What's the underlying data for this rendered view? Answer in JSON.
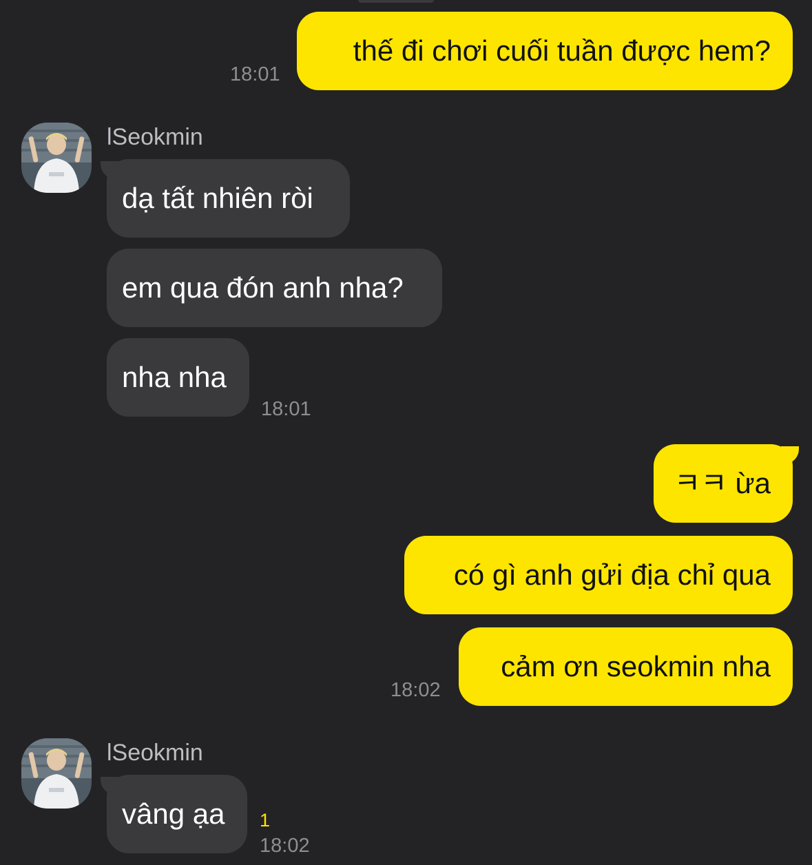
{
  "chat": {
    "contact_name": "lSeokmin",
    "messages": [
      {
        "text": "thế đi chơi cuối tuần được hem?",
        "time": "18:01"
      },
      {
        "text": "dạ tất nhiên ròi"
      },
      {
        "text": "em qua đón anh nha?"
      },
      {
        "text": "nha nha",
        "time": "18:01"
      },
      {
        "text": "ㅋㅋ ừa"
      },
      {
        "text": "có gì anh gửi địa chỉ qua"
      },
      {
        "text": "cảm ơn seokmin nha",
        "time": "18:02"
      },
      {
        "text": "vâng ạa",
        "time": "18:02",
        "unread": "1"
      }
    ]
  },
  "colors": {
    "background": "#232325",
    "outgoing_bubble": "#FEE500",
    "incoming_bubble": "#3a3a3c",
    "timestamp": "#8e8e93",
    "unread_count": "#FEE500"
  },
  "icons": {
    "avatar": "profile-photo"
  }
}
